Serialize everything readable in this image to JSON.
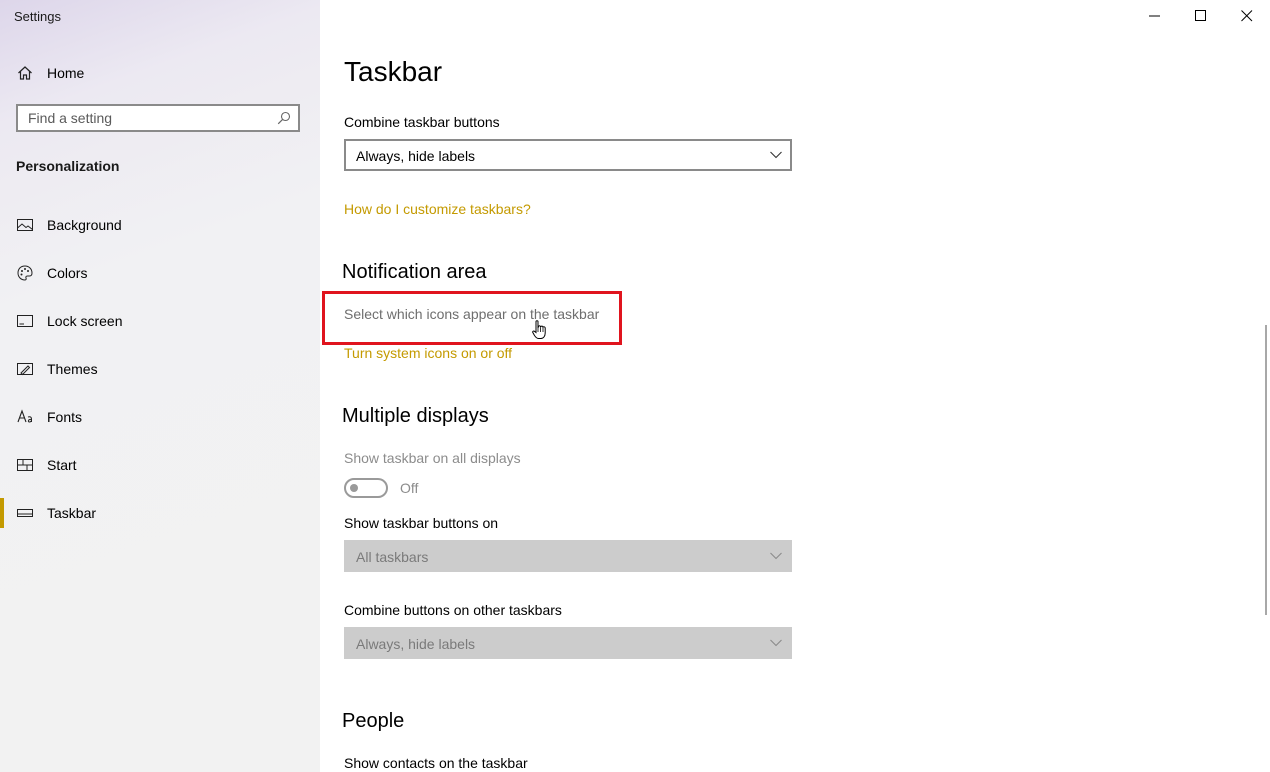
{
  "window": {
    "title": "Settings",
    "controls": {
      "minimize": "minimize-icon",
      "maximize": "maximize-icon",
      "close": "close-icon"
    }
  },
  "sidebar": {
    "home_label": "Home",
    "search_placeholder": "Find a setting",
    "section": "Personalization",
    "items": [
      {
        "label": "Background",
        "icon": "picture-icon"
      },
      {
        "label": "Colors",
        "icon": "palette-icon"
      },
      {
        "label": "Lock screen",
        "icon": "lock-screen-icon"
      },
      {
        "label": "Themes",
        "icon": "themes-icon"
      },
      {
        "label": "Fonts",
        "icon": "fonts-icon"
      },
      {
        "label": "Start",
        "icon": "start-icon"
      },
      {
        "label": "Taskbar",
        "icon": "taskbar-icon",
        "active": true
      }
    ],
    "accent": "#c49a00"
  },
  "main": {
    "title": "Taskbar",
    "combine": {
      "label": "Combine taskbar buttons",
      "value": "Always, hide labels"
    },
    "customize_link": "How do I customize taskbars?",
    "notification": {
      "heading": "Notification area",
      "select_icons_link": "Select which icons appear on the taskbar",
      "system_icons_link": "Turn system icons on or off"
    },
    "multiple": {
      "heading": "Multiple displays",
      "show_all_label": "Show taskbar on all displays",
      "toggle_state": "Off",
      "buttons_on_label": "Show taskbar buttons on",
      "buttons_on_value": "All taskbars",
      "combine_other_label": "Combine buttons on other taskbars",
      "combine_other_value": "Always, hide labels"
    },
    "people": {
      "heading": "People",
      "contacts_label": "Show contacts on the taskbar"
    }
  },
  "colors": {
    "link": "#c49a00",
    "highlight": "#e0141e"
  }
}
